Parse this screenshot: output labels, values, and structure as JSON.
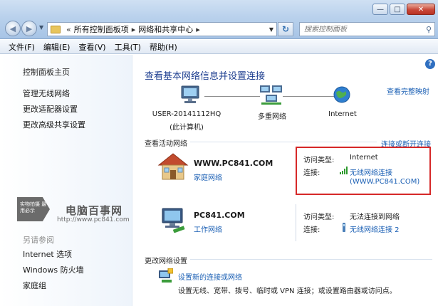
{
  "window": {
    "minimize_glyph": "—",
    "maximize_glyph": "□",
    "close_glyph": "✕"
  },
  "address_bar": {
    "crumbs": [
      "所有控制面板项",
      "网络和共享中心"
    ],
    "separator": "▸",
    "prefix": "«"
  },
  "search": {
    "placeholder": "搜索控制面板"
  },
  "menu": [
    "文件(F)",
    "编辑(E)",
    "查看(V)",
    "工具(T)",
    "帮助(H)"
  ],
  "sidebar": {
    "home": "控制面板主页",
    "links": [
      "管理无线网络",
      "更改适配器设置",
      "更改高级共享设置"
    ],
    "see_also_heading": "另请参阅",
    "see_also": [
      "Internet 选项",
      "Windows 防火墙",
      "家庭组"
    ]
  },
  "watermark": {
    "badge": "实物拍摄 最用必示",
    "title": "电脑百事网",
    "url": "http://www.pc841.com"
  },
  "main": {
    "title": "查看基本网络信息并设置连接",
    "view_full_map": "查看完整映射",
    "map": {
      "computer_name": "USER-20141112HQ",
      "computer_sub": "(此计算机)",
      "middle": "多重网络",
      "internet": "Internet"
    },
    "active_heading": "查看活动网络",
    "connect_link": "连接或断开连接",
    "networks": [
      {
        "name": "WWW.PC841.COM",
        "type": "家庭网络",
        "access_label": "访问类型:",
        "access_value": "Internet",
        "conn_label": "连接:",
        "conn_value": "无线网络连接",
        "conn_value2": "(WWW.PC841.COM)"
      },
      {
        "name": "PC841.COM",
        "type": "工作网络",
        "access_label": "访问类型:",
        "access_value": "无法连接到网络",
        "conn_label": "连接:",
        "conn_value": "无线网络连接 2"
      }
    ],
    "change_heading": "更改网络设置",
    "change_task": "设置新的连接或网络",
    "change_desc": "设置无线、宽带、拨号、临时或 VPN 连接；或设置路由器或访问点。"
  },
  "colors": {
    "link": "#1a5fb4",
    "title": "#1e3f90",
    "highlight_box": "#d62828"
  }
}
